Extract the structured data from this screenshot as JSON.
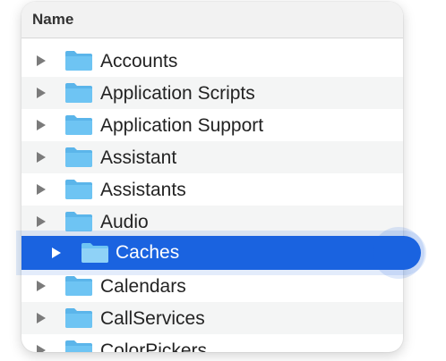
{
  "header": {
    "column_name": "Name"
  },
  "rows": [
    {
      "label": "Accounts"
    },
    {
      "label": "Application Scripts"
    },
    {
      "label": "Application Support"
    },
    {
      "label": "Assistant"
    },
    {
      "label": "Assistants"
    },
    {
      "label": "Audio"
    },
    {
      "label": ""
    },
    {
      "label": "Calendars"
    },
    {
      "label": "CallServices"
    },
    {
      "label": "ColorPickers"
    }
  ],
  "selected": {
    "label": "Caches"
  },
  "colors": {
    "selection": "#1a63e0",
    "folder_fill": "#6ec4f3",
    "folder_tab": "#5bb5ea"
  },
  "icons": {
    "disclosure": "disclosure-triangle-icon",
    "folder": "folder-icon"
  }
}
